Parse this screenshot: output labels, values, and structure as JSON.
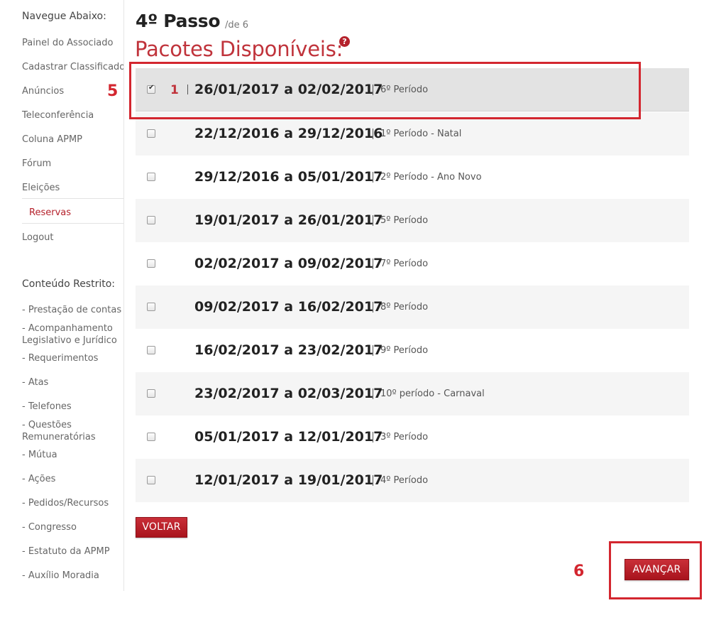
{
  "sidebar": {
    "heading": "Navegue Abaixo:",
    "items": [
      {
        "label": "Painel do Associado"
      },
      {
        "label": "Cadastrar Classificado"
      },
      {
        "label": "Anúncios"
      },
      {
        "label": "Teleconferência"
      },
      {
        "label": "Coluna APMP"
      },
      {
        "label": "Fórum"
      },
      {
        "label": "Eleições"
      },
      {
        "label": "Reservas"
      },
      {
        "label": "Logout"
      }
    ],
    "restricted_heading": "Conteúdo Restrito:",
    "restricted_items": [
      {
        "label": "- Prestação de contas"
      },
      {
        "label": "- Acompanhamento",
        "label2": "Legislativo e Jurídico"
      },
      {
        "label": "- Requerimentos"
      },
      {
        "label": "- Atas"
      },
      {
        "label": "- Telefones"
      },
      {
        "label": "- Questões",
        "label2": "Remuneratórias"
      },
      {
        "label": "- Mútua"
      },
      {
        "label": "- Ações"
      },
      {
        "label": "- Pedidos/Recursos"
      },
      {
        "label": "- Congresso"
      },
      {
        "label": "- Estatuto da APMP"
      },
      {
        "label": "- Auxílio Moradia"
      }
    ]
  },
  "header": {
    "step": "4º Passo",
    "step_of": "/de 6",
    "section_title": "Pacotes Disponíveis:",
    "help_icon": "?"
  },
  "packages": [
    {
      "checked": true,
      "number": "1",
      "dates": "26/01/2017 a 02/02/2017",
      "period": "6º Período"
    },
    {
      "checked": false,
      "dates": "22/12/2016 a 29/12/2016",
      "period": "1º Período - Natal"
    },
    {
      "checked": false,
      "dates": "29/12/2016 a 05/01/2017",
      "period": "2º Período - Ano Novo"
    },
    {
      "checked": false,
      "dates": "19/01/2017 a 26/01/2017",
      "period": "5º Período"
    },
    {
      "checked": false,
      "dates": "02/02/2017 a 09/02/2017",
      "period": "7º Período"
    },
    {
      "checked": false,
      "dates": "09/02/2017 a 16/02/2017",
      "period": "8º Período"
    },
    {
      "checked": false,
      "dates": "16/02/2017 a 23/02/2017",
      "period": "9º Período"
    },
    {
      "checked": false,
      "dates": "23/02/2017 a 02/03/2017",
      "period": "10º período - Carnaval"
    },
    {
      "checked": false,
      "dates": "05/01/2017 a 12/01/2017",
      "period": "3º Período"
    },
    {
      "checked": false,
      "dates": "12/01/2017 a 19/01/2017",
      "period": "4º Período"
    }
  ],
  "buttons": {
    "back": "VOLTAR",
    "next": "AVANÇAR"
  },
  "annotations": {
    "step5": "5",
    "step6": "6"
  },
  "colors": {
    "accent": "#c0333b",
    "annotation": "#d3262f",
    "button": "#b5222c"
  }
}
